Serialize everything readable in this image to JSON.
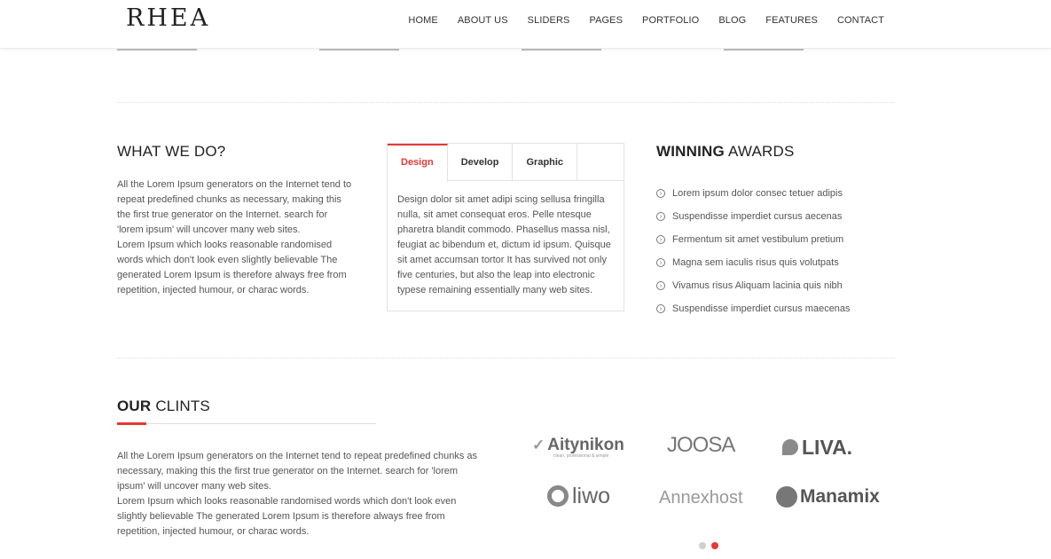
{
  "header": {
    "logo": "RHEA",
    "nav": [
      "HOME",
      "ABOUT US",
      "SLIDERS",
      "PAGES",
      "PORTFOLIO",
      "BLOG",
      "FEATURES",
      "CONTACT"
    ]
  },
  "what_we_do": {
    "title": "WHAT WE DO?",
    "lines": [
      "All the Lorem Ipsum generators on the Internet tend to",
      "repeat predefined chunks as necessary, making this",
      "the first true generator on the Internet. search for",
      "'lorem ipsum' will uncover many web sites.",
      "Lorem Ipsum which looks reasonable randomised",
      "words which don't look even slightly believable The",
      "generated Lorem Ipsum is therefore always free from",
      "repetition, injected humour, or charac words."
    ]
  },
  "tabs": {
    "labels": [
      "Design",
      "Develop",
      "Graphic"
    ],
    "active": "Design",
    "content_lines": [
      "Design dolor sit amet adipi scing sellusa fringilla",
      "nulla, sit amet consequat eros. Pelle ntesque",
      "pharetra blandit commodo. Phasellus massa nisl,",
      "feugiat ac bibendum et, dictum id ipsum. Quisque",
      "sit amet accumsan tortor It has survived not only",
      "five centuries, but also the leap into electronic",
      "typese remaining essentially many web sites."
    ]
  },
  "awards": {
    "title_bold": "WINNING",
    "title_rest": " AWARDS",
    "items": [
      "Lorem ipsum dolor consec tetuer adipis",
      "Suspendisse imperdiet cursus aecenas",
      "Fermentum sit amet vestibulum pretium",
      "Magna sem iaculis risus quis volutpats",
      "Vivamus risus Aliquam lacinia quis nibh",
      "Suspendisse imperdiet cursus maecenas"
    ]
  },
  "clients": {
    "title_bold": "OUR",
    "title_rest": " CLINTS",
    "lines": [
      "All the Lorem Ipsum generators on the Internet tend to repeat predefined chunks as",
      "necessary, making this the first true generator on the Internet. search for 'lorem",
      "ipsum' will uncover many web sites.",
      "Lorem Ipsum which looks reasonable randomised words which don't look even",
      "slightly believable The generated Lorem Ipsum is therefore always free from",
      "repetition, injected humour, or charac words."
    ],
    "logos": {
      "aitynikon": "Aitynikon",
      "aitynikon_tagline": "clean, professional & simple",
      "joosa": "JOOSA",
      "liva": "LIVA.",
      "liwo": "liwo",
      "annexhost": "Annexhost",
      "manamix": "Manamix"
    },
    "carousel_pages": 2,
    "carousel_active": 2
  },
  "colors": {
    "accent": "#e53935",
    "text": "#555555",
    "heading": "#222222"
  }
}
